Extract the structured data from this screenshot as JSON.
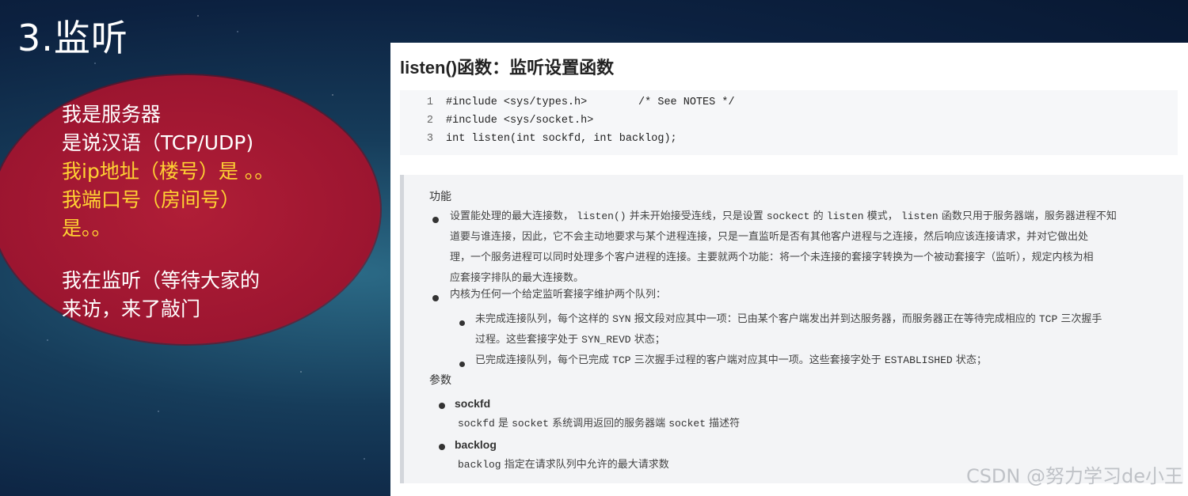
{
  "slide": {
    "title": "3.监听",
    "bubble_lines": [
      "我是服务器",
      "是说汉语（TCP/UDP)",
      "我ip地址（楼号）是 。。",
      "我端口号（房间号）",
      "是。。",
      "我在监听（等待大家的",
      "来访，来了敲门"
    ]
  },
  "doc": {
    "heading": "listen()函数：监听设置函数",
    "code": [
      {
        "ln": "1",
        "text": "#include <sys/types.h>        /* See NOTES */"
      },
      {
        "ln": "2",
        "text": "#include <sys/socket.h>"
      },
      {
        "ln": "3",
        "text": "int listen(int sockfd, int backlog);"
      }
    ],
    "section_function": "功能",
    "func_para1": {
      "line1_a": "设置能处理的最大连接数，",
      "line1_code1": "listen()",
      "line1_b": "并未开始接受连线，只是设置",
      "line1_code2": "sockect",
      "line1_c": "的",
      "line1_code3": "listen",
      "line1_d": "模式，",
      "line1_code4": "listen",
      "line1_e": "函数只用于服务器端，服务器进程不知",
      "line2": "道要与谁连接，因此，它不会主动地要求与某个进程连接，只是一直监听是否有其他客户进程与之连接，然后响应该连接请求，并对它做出处",
      "line3": "理，一个服务进程可以同时处理多个客户进程的连接。主要就两个功能：将一个未连接的套接字转换为一个被动套接字（监听），规定内核为相",
      "line4": "应套接字排队的最大连接数。"
    },
    "func_para2": "内核为任何一个给定监听套接字维护两个队列：",
    "queue1": {
      "a": "未完成连接队列，每个这样的",
      "code1": "SYN",
      "b": "报文段对应其中一项：已由某个客户端发出并到达服务器，而服务器正在等待完成相应的",
      "code2": "TCP",
      "c": "三次握手",
      "line2_a": "过程。这些套接字处于",
      "line2_code": "SYN_REVD",
      "line2_b": "状态；"
    },
    "queue2": {
      "a": "已完成连接队列，每个已完成",
      "code1": "TCP",
      "b": "三次握手过程的客户端对应其中一项。这些套接字处于",
      "code2": "ESTABLISHED",
      "c": "状态；"
    },
    "section_params": "参数",
    "params": [
      {
        "name": "sockfd",
        "desc_code1": "sockfd",
        "desc_a": "是",
        "desc_code2": "socket",
        "desc_b": "系统调用返回的服务器端",
        "desc_code3": "socket",
        "desc_c": "描述符"
      },
      {
        "name": "backlog",
        "desc_code1": "backlog",
        "desc_a": "指定在请求队列中允许的最大请求数"
      }
    ]
  },
  "watermark": "CSDN @努力学习de小王",
  "colors": {
    "bubble": "#a3182f",
    "highlight": "#ffd233",
    "title": "#ffffff"
  }
}
